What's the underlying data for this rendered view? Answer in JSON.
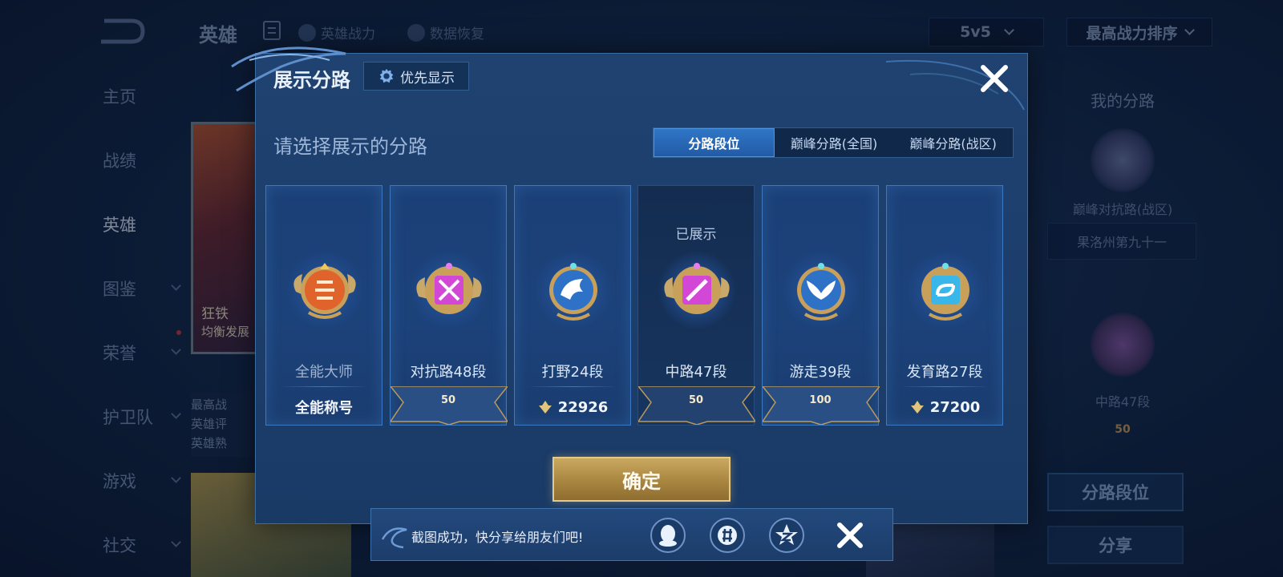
{
  "background": {
    "title": "英雄",
    "links": [
      {
        "label": "英雄战力"
      },
      {
        "label": "数据恢复"
      }
    ],
    "mode_select": {
      "value": "5v5"
    },
    "sort_select": {
      "value": "最高战力排序"
    },
    "sidebar": [
      {
        "label": "主页"
      },
      {
        "label": "战绩"
      },
      {
        "label": "英雄"
      },
      {
        "label": "图鉴"
      },
      {
        "label": "荣誉"
      },
      {
        "label": "护卫队"
      },
      {
        "label": "游戏"
      },
      {
        "label": "社交"
      }
    ],
    "hero_card": {
      "name": "狂铁",
      "subtitle": "均衡发展"
    },
    "hero_stats": [
      "最高战",
      "英雄评",
      "英雄熟"
    ],
    "right_panel": {
      "title": "我的分路",
      "peak_label": "巅峰对抗路(战区)",
      "peak_region": "果洛州第九十一",
      "rank_label": "中路47段",
      "rank_num": "50",
      "btn_route": "分路段位",
      "btn_share": "分享"
    }
  },
  "modal": {
    "title": "展示分路",
    "priority_label": "优先显示",
    "prompt": "请选择展示的分路",
    "tabs": [
      {
        "label": "分路段位",
        "active": true
      },
      {
        "label": "巅峰分路(全国)",
        "active": false
      },
      {
        "label": "巅峰分路(战区)",
        "active": false
      }
    ],
    "cards": [
      {
        "name": "全能大师",
        "bottom_text": "全能称号",
        "type": "title",
        "emblem": "allround-emblem-icon",
        "color": "#e0632b",
        "shown": false
      },
      {
        "name": "对抗路48段",
        "rank_num": "50",
        "type": "ribbon",
        "emblem": "clash-lane-emblem-icon",
        "color": "#d347d6",
        "shown": false
      },
      {
        "name": "打野24段",
        "bottom_text": "22926",
        "type": "peak",
        "emblem": "jungle-emblem-icon",
        "color": "#3f8fe3",
        "shown": false
      },
      {
        "name": "中路47段",
        "rank_num": "50",
        "type": "ribbon",
        "emblem": "mid-lane-emblem-icon",
        "color": "#d347d6",
        "shown": true,
        "status": "已展示"
      },
      {
        "name": "游走39段",
        "rank_num": "100",
        "type": "ribbon",
        "emblem": "roam-emblem-icon",
        "color": "#3f8fe3",
        "shown": false
      },
      {
        "name": "发育路27段",
        "bottom_text": "27200",
        "type": "peak",
        "emblem": "farm-lane-emblem-icon",
        "color": "#39b6ea",
        "shown": false
      }
    ],
    "confirm_label": "确定"
  },
  "toast": {
    "message": "截图成功，快分享给朋友们吧!",
    "share_icons": [
      "qq-icon",
      "wechat-moments-icon",
      "qzone-icon"
    ]
  },
  "colors": {
    "accent_blue": "#2f76c6",
    "gold": "#c9a860",
    "panel": "#1f4271"
  }
}
